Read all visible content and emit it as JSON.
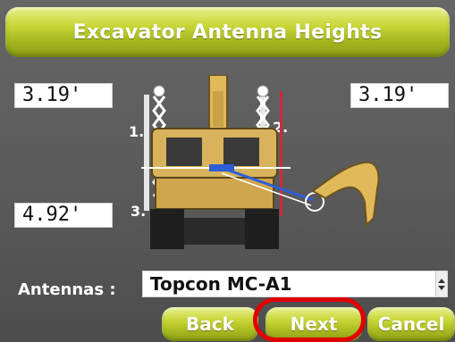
{
  "window": {
    "title": "Excavator Antenna Heights"
  },
  "heights": {
    "left_top": "3.19'",
    "right_top": "3.19'",
    "left_bottom": "4.92'"
  },
  "markers": {
    "m1": "1.",
    "m2": "2.",
    "m3": "3."
  },
  "antennas": {
    "label": "Antennas :",
    "selected": "Topcon MC-A1"
  },
  "buttons": {
    "back": "Back",
    "next": "Next",
    "cancel": "Cancel"
  },
  "colors": {
    "accent": "#b4c62a",
    "highlight": "#e00000",
    "background": "#5c5c5c"
  }
}
